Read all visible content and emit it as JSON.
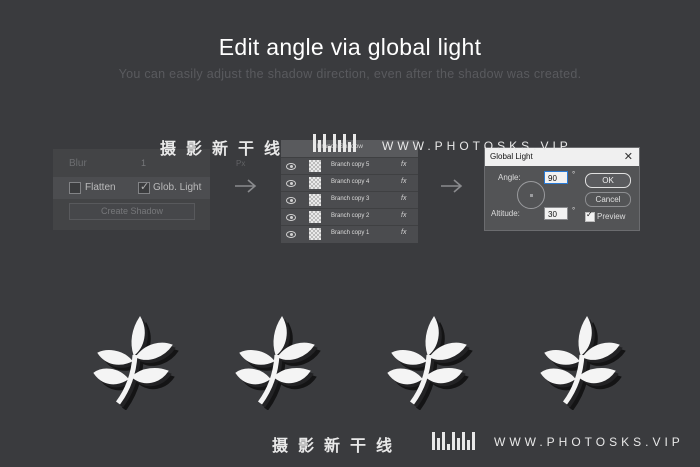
{
  "header": {
    "title": "Edit angle via global light",
    "subtitle": "You can easily adjust the shadow direction, even after the shadow was created."
  },
  "left_panel": {
    "blur_label": "Blur",
    "blur_value": "1",
    "blur_unit": "Px",
    "flatten_label": "Flatten",
    "flatten_checked": false,
    "glob_light_label": "Glob. Light",
    "glob_light_checked": true,
    "create_shadow_label": "Create Shadow"
  },
  "layers_panel": {
    "group_label": "Branch Shadow",
    "layers": [
      {
        "label": "Branch copy 5",
        "fx": "fx"
      },
      {
        "label": "Branch copy 4",
        "fx": "fx"
      },
      {
        "label": "Branch copy 3",
        "fx": "fx"
      },
      {
        "label": "Branch copy 2",
        "fx": "fx"
      },
      {
        "label": "Branch copy 1",
        "fx": "fx"
      }
    ]
  },
  "dialog": {
    "title": "Global Light",
    "close": "✕",
    "angle_label": "Angle:",
    "angle_value": "90",
    "degree_symbol": "°",
    "altitude_label": "Altitude:",
    "altitude_value": "30",
    "ok_label": "OK",
    "cancel_label": "Cancel",
    "preview_label": "Preview",
    "preview_checked": true
  },
  "watermark": {
    "chinese": "摄影新干线",
    "url": "WWW.PHOTOSKS.VIP"
  },
  "leaves_count": 4,
  "colors": {
    "background": "#3a3b3e",
    "leaf": "#f4f4f4",
    "leaf_shadow": "#1a1a1b",
    "accent_focus": "#2a7bd6"
  }
}
